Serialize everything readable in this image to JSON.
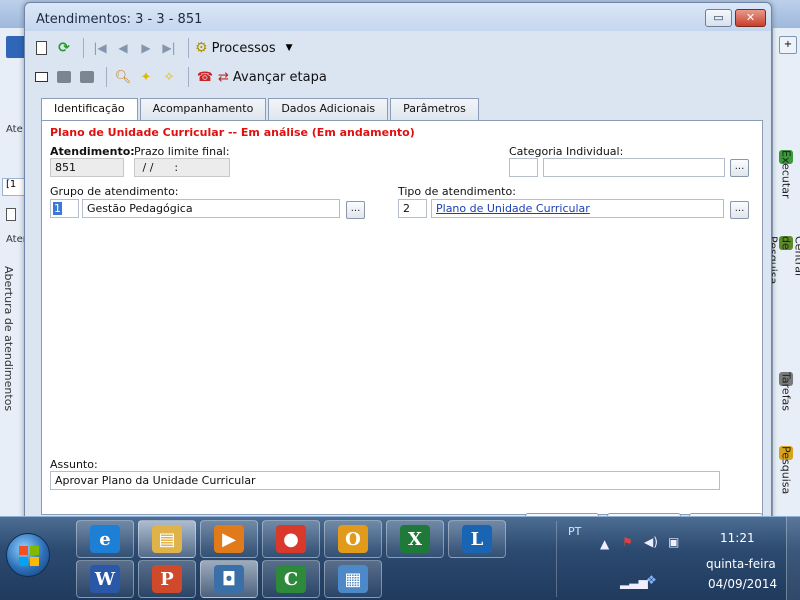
{
  "dialog": {
    "title": "Atendimentos: 3 - 3 - 851",
    "minimize_glyph": "▭",
    "close_glyph": "✕"
  },
  "toolbar1": {
    "processos_label": "Processos",
    "dropdown_glyph": "▼"
  },
  "toolbar2": {
    "avancar_label": "Avançar etapa"
  },
  "tabs": [
    {
      "label": "Identificação",
      "active": true
    },
    {
      "label": "Acompanhamento",
      "active": false
    },
    {
      "label": "Dados Adicionais",
      "active": false
    },
    {
      "label": "Parâmetros",
      "active": false
    }
  ],
  "form": {
    "status_title": "Plano de Unidade Curricular -- Em análise (Em andamento)",
    "atendimento_label": "Atendimento:",
    "atendimento_value": "851",
    "prazo_label": "Prazo limite final:",
    "prazo_value": " / /      :",
    "categoria_label": "Categoria Individual:",
    "categoria_code": "",
    "categoria_desc": "",
    "grupo_label": "Grupo de atendimento:",
    "grupo_code": "1",
    "grupo_desc": "Gestão Pedagógica",
    "tipo_label": "Tipo de atendimento:",
    "tipo_code": "2",
    "tipo_desc": "Plano de Unidade Curricular",
    "assunto_label": "Assunto:",
    "assunto_value": "Aprovar Plano da Unidade Curricular",
    "ellipsis": "..."
  },
  "background": {
    "left_label_1": "Ate",
    "left_tab": "[1",
    "left_label_2": "Aten",
    "left_vertical": "Abertura de atendimentos",
    "right_top_glyph": "+",
    "right_items": [
      {
        "label": "Executar",
        "color": "#3a9a3a"
      },
      {
        "label": "Central de Pesquisa",
        "color": "#5a8a2a"
      },
      {
        "label": "Tarefas",
        "color": "#7a7a7a"
      },
      {
        "label": "Pesquisa",
        "color": "#d8a21a"
      }
    ]
  },
  "taskbar": {
    "apps": [
      {
        "name": "internet-explorer",
        "glyph": "e",
        "color": "#1d7fd6",
        "active": false
      },
      {
        "name": "windows-explorer",
        "glyph": "▤",
        "color": "#e0b34a",
        "active": true
      },
      {
        "name": "media-player",
        "glyph": "▶",
        "color": "#e07a1a",
        "active": false
      },
      {
        "name": "chrome",
        "glyph": "●",
        "color": "#d9392b",
        "active": false
      },
      {
        "name": "outlook",
        "glyph": "O",
        "color": "#e29a1a",
        "active": false
      },
      {
        "name": "excel",
        "glyph": "X",
        "color": "#1f7a3a",
        "active": false
      },
      {
        "name": "lync",
        "glyph": "L",
        "color": "#1a64b4",
        "active": false
      },
      {
        "name": "word",
        "glyph": "W",
        "color": "#2b57a8",
        "active": false
      },
      {
        "name": "powerpoint",
        "glyph": "P",
        "color": "#d0492a",
        "active": false
      },
      {
        "name": "virtual-machine",
        "glyph": "◘",
        "color": "#3b6fa8",
        "active": true
      },
      {
        "name": "camtasia",
        "glyph": "C",
        "color": "#2d8a3a",
        "active": false
      },
      {
        "name": "app-window",
        "glyph": "▦",
        "color": "#4d88c8",
        "active": false
      }
    ],
    "lang": "PT",
    "time": "11:21",
    "day": "quinta-feira",
    "date": "04/09/2014"
  }
}
